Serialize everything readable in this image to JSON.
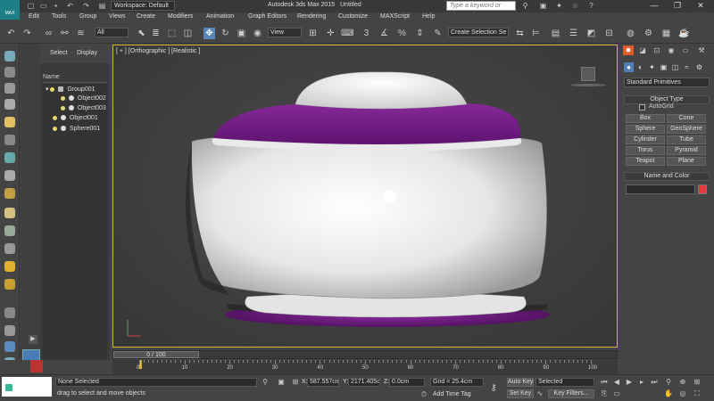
{
  "window": {
    "app_logo": "MAX",
    "workspace": "Workspace: Default",
    "app_title": "Autodesk 3ds Max 2015",
    "doc_title": "Untitled",
    "search_placeholder": "Type a keyword or phrase",
    "controls": [
      "—",
      "❐",
      "✕"
    ]
  },
  "menu": [
    "Edit",
    "Tools",
    "Group",
    "Views",
    "Create",
    "Modifiers",
    "Animation",
    "Graph Editors",
    "Rendering",
    "Customize",
    "MAXScript",
    "Help"
  ],
  "toolbar": {
    "filter": "All",
    "ref_coord": "View",
    "snap_label": "3",
    "selection_set": "Create Selection Se"
  },
  "explorer": {
    "tabs": [
      "Select",
      "Display"
    ],
    "column_header": "Name",
    "items": [
      {
        "label": "Group001",
        "level": 0,
        "expander": "▾"
      },
      {
        "label": "Object002",
        "level": 1
      },
      {
        "label": "Object003",
        "level": 1
      },
      {
        "label": "Object001",
        "level": 0
      },
      {
        "label": "Sphere001",
        "level": 0
      }
    ]
  },
  "viewport": {
    "label": "[ + ] [Orthographic ] [Realistic ]",
    "object_colors": {
      "shell": "#f2f2f2",
      "band": "#7a1c8c",
      "shadow": "#2a2a2a"
    }
  },
  "command_panel": {
    "category": "Standard Primitives",
    "object_type_title": "Object Type",
    "autogrid": "AutoGrid",
    "buttons": [
      "Box",
      "Cone",
      "Sphere",
      "GeoSphere",
      "Cylinder",
      "Tube",
      "Torus",
      "Pyramid",
      "Teapot",
      "Plane"
    ],
    "name_color_title": "Name and Color",
    "name_value": "",
    "swatch_color": "#e03a3a"
  },
  "timeline": {
    "frame_display": "0 / 100",
    "ticks": [
      0,
      10,
      20,
      30,
      40,
      50,
      60,
      70,
      80,
      90,
      100
    ]
  },
  "status": {
    "maxscript": "",
    "selection": "None Selected",
    "prompt": "drag to select and move objects",
    "x_label": "X:",
    "x_value": "587.557cm",
    "y_label": "Y:",
    "y_value": "2171.405c",
    "z_label": "Z:",
    "z_value": "0.0cm",
    "grid": "Grid = 25.4cm",
    "add_time_tag": "Add Time Tag",
    "auto_key": "Auto Key",
    "set_key": "Set Key",
    "key_mode": "Selected",
    "key_filters": "Key Filters..."
  },
  "accent_colors": {
    "active_tool": "#5b87b8",
    "viewport_border": "#d9b23a",
    "create_tab": "#e05a2b"
  }
}
